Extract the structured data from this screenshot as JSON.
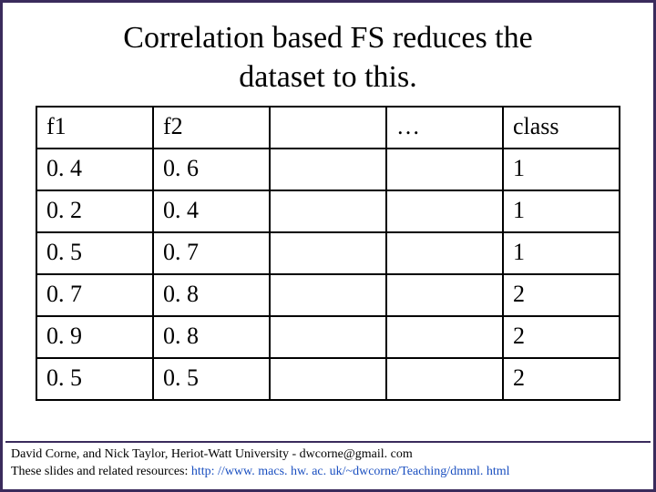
{
  "title_line1": "Correlation based FS reduces the",
  "title_line2": "dataset to this.",
  "chart_data": {
    "type": "table",
    "columns": [
      "f1",
      "f2",
      "",
      "…",
      "class"
    ],
    "rows": [
      [
        "0. 4",
        "0. 6",
        "",
        "",
        "1"
      ],
      [
        "0. 2",
        "0. 4",
        "",
        "",
        "1"
      ],
      [
        "0. 5",
        "0. 7",
        "",
        "",
        "1"
      ],
      [
        "0. 7",
        "0. 8",
        "",
        "",
        "2"
      ],
      [
        "0. 9",
        "0. 8",
        "",
        "",
        "2"
      ],
      [
        "0. 5",
        "0. 5",
        "",
        "",
        "2"
      ]
    ]
  },
  "footer": {
    "line1": "David Corne, and Nick Taylor,  Heriot-Watt University  -  dwcorne@gmail. com",
    "line2_prefix": "These slides and related resources:   ",
    "line2_link": "http: //www. macs. hw. ac. uk/~dwcorne/Teaching/dmml. html"
  }
}
